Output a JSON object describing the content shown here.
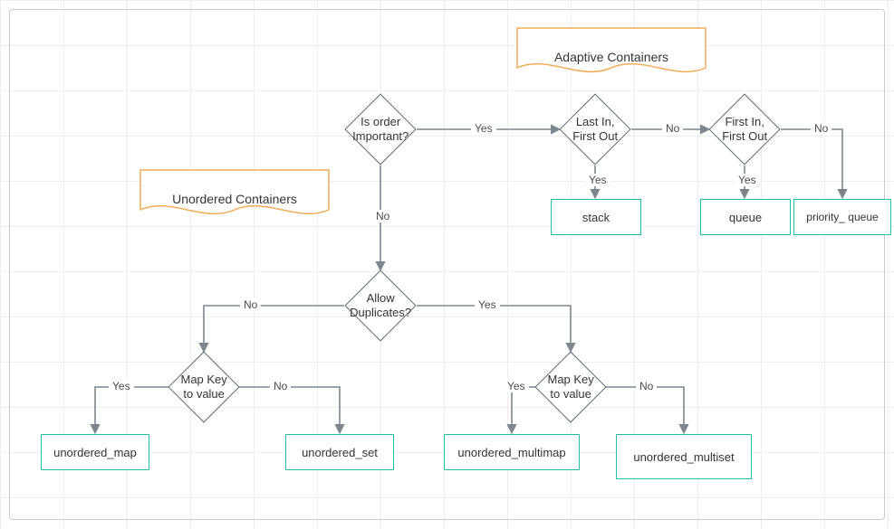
{
  "headers": {
    "adaptive": "Adaptive Containers",
    "unordered": "Unordered Containers"
  },
  "decisions": {
    "is_order_important": "Is order Important?",
    "lifo": "Last In, First Out",
    "fifo": "First In, First Out",
    "allow_duplicates": "Allow Duplicates?",
    "map_key_left": "Map Key to value",
    "map_key_right": "Map Key to value"
  },
  "results": {
    "stack": "stack",
    "queue": "queue",
    "priority_queue": "priority_ queue",
    "unordered_map": "unordered_map",
    "unordered_set": "unordered_set",
    "unordered_multimap": "unordered_multimap",
    "unordered_multiset": "unordered_multiset"
  },
  "labels": {
    "yes": "Yes",
    "no": "No"
  }
}
